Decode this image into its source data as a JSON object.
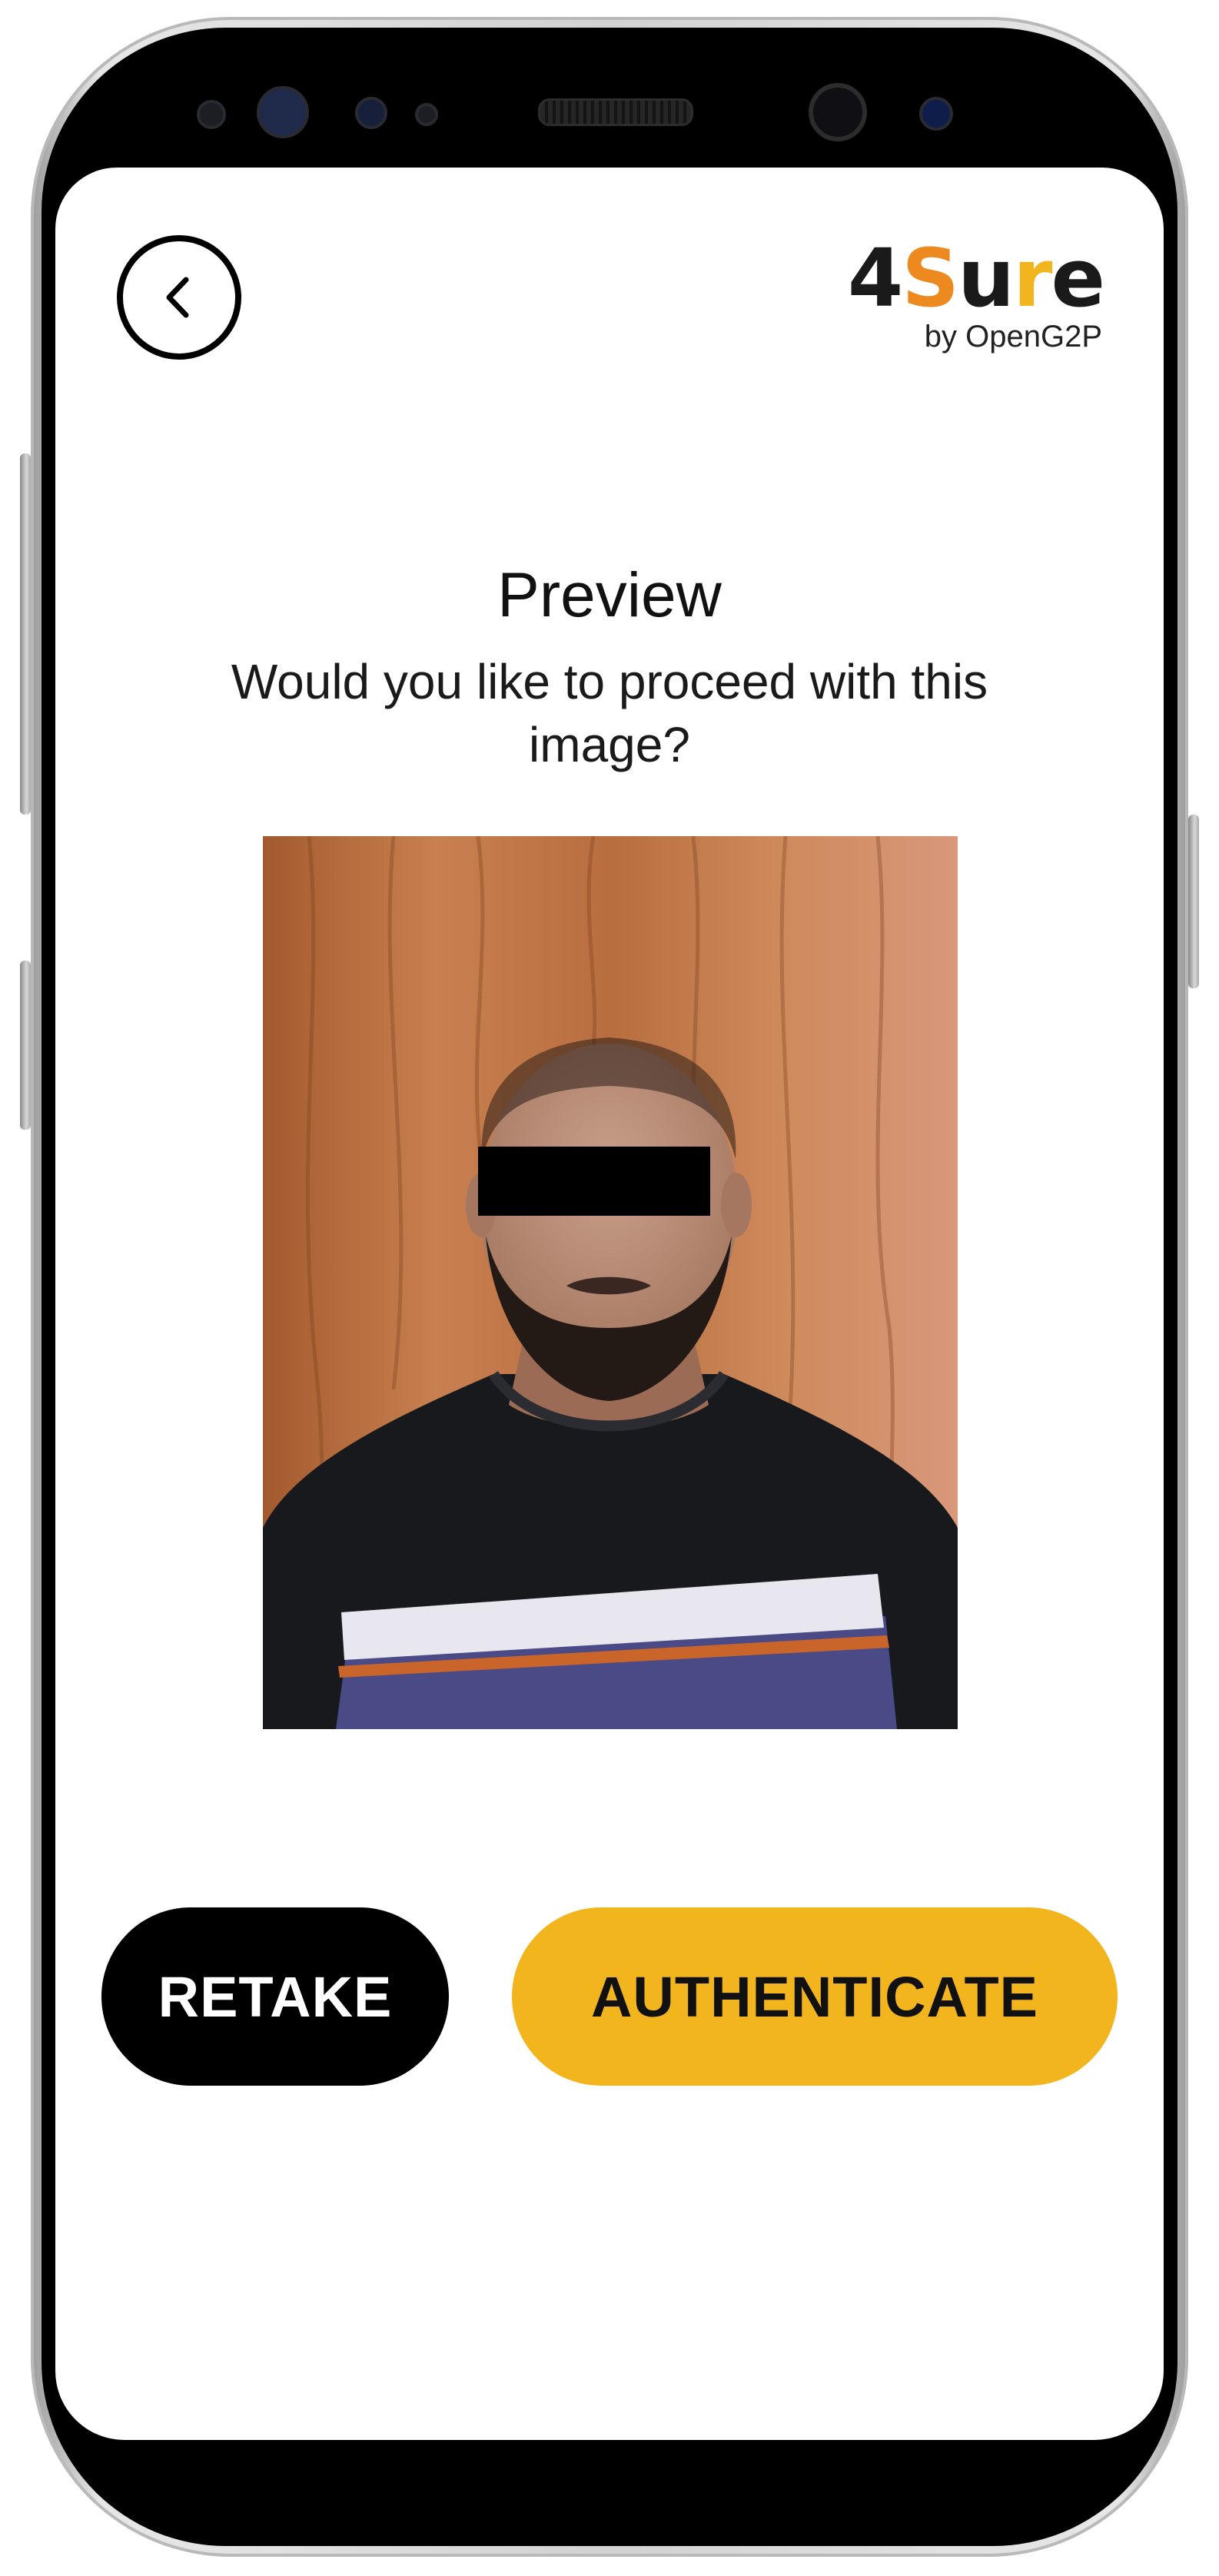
{
  "header": {
    "back_icon": "chevron-left-icon",
    "brand": {
      "part_4": "4",
      "part_s": "S",
      "part_u": "u",
      "part_r": "r",
      "part_e": "e",
      "subtitle": "by OpenG2P"
    }
  },
  "main": {
    "title": "Preview",
    "subtitle": "Would you like to proceed with this image?"
  },
  "actions": {
    "retake_label": "RETAKE",
    "authenticate_label": "AUTHENTICATE"
  },
  "colors": {
    "accent": "#f2b51d",
    "brand_orange": "#ec8a1f",
    "retake_bg": "#000000"
  }
}
